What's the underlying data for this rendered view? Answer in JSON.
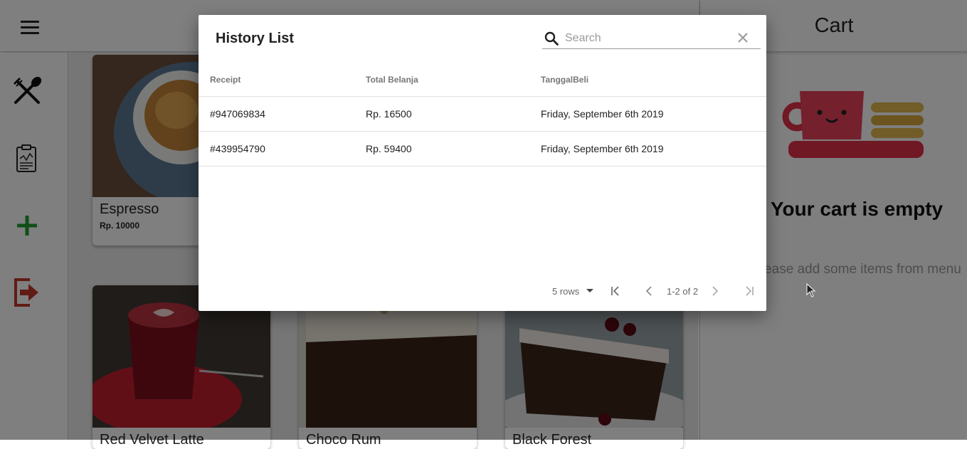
{
  "sidebar": {
    "items": [
      {
        "icon": "utensils-icon"
      },
      {
        "icon": "clipboard-icon"
      },
      {
        "icon": "plus-icon",
        "color": "#1e9e2f"
      },
      {
        "icon": "logout-icon",
        "color": "#c0392b"
      }
    ]
  },
  "menu": {
    "items": [
      {
        "name": "Espresso",
        "price": "Rp. 10000"
      },
      {
        "name": "Red Velvet Latte"
      },
      {
        "name": "Choco Rum"
      },
      {
        "name": "Black Forest"
      }
    ]
  },
  "cart": {
    "title": "Cart",
    "empty_title": "Your cart is empty",
    "empty_subtitle": "Please add some items from menu"
  },
  "history": {
    "title": "History List",
    "search_placeholder": "Search",
    "columns": [
      "Receipt",
      "Total Belanja",
      "TanggalBeli"
    ],
    "rows": [
      {
        "receipt": "#947069834",
        "total": "Rp. 16500",
        "date": "Friday, September 6th 2019"
      },
      {
        "receipt": "#439954790",
        "total": "Rp. 59400",
        "date": "Friday, September 6th 2019"
      }
    ],
    "pagination": {
      "rows_per_page": "5 rows",
      "range": "1-2 of 2"
    }
  },
  "colors": {
    "accent_red": "#d63a4a",
    "accent_green": "#1e9e2f"
  }
}
